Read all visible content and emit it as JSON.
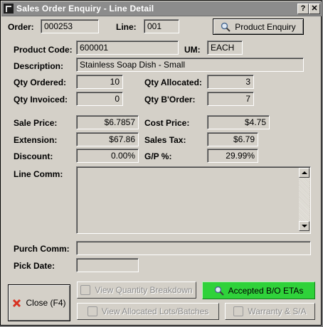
{
  "window": {
    "title": "Sales Order Enquiry - Line Detail",
    "help_label": "?",
    "close_label": "✕"
  },
  "header": {
    "order_label": "Order:",
    "order_value": "000253",
    "line_label": "Line:",
    "line_value": "001",
    "product_enquiry_label": "Product Enquiry"
  },
  "product": {
    "code_label": "Product Code:",
    "code_value": "600001",
    "um_label": "UM:",
    "um_value": "EACH",
    "description_label": "Description:",
    "description_value": "Stainless Soap Dish - Small"
  },
  "quantities": {
    "ordered_label": "Qty Ordered:",
    "ordered_value": "10",
    "allocated_label": "Qty Allocated:",
    "allocated_value": "3",
    "invoiced_label": "Qty Invoiced:",
    "invoiced_value": "0",
    "border_label": "Qty B'Order:",
    "border_value": "7"
  },
  "pricing": {
    "sale_price_label": "Sale Price:",
    "sale_price_value": "$6.7857",
    "cost_price_label": "Cost Price:",
    "cost_price_value": "$4.75",
    "extension_label": "Extension:",
    "extension_value": "$67.86",
    "sales_tax_label": "Sales Tax:",
    "sales_tax_value": "$6.79",
    "discount_label": "Discount:",
    "discount_value": "0.00%",
    "gp_label": "G/P %:",
    "gp_value": "29.99%"
  },
  "comments": {
    "line_comm_label": "Line Comm:",
    "line_comm_value": "",
    "purch_comm_label": "Purch Comm:",
    "purch_comm_value": "",
    "pick_date_label": "Pick Date:",
    "pick_date_value": ""
  },
  "buttons": {
    "close_label": "Close (F4)",
    "view_qty_breakdown_label": "View Quantity Breakdown",
    "accepted_bo_etas_label": "Accepted B/O ETAs",
    "view_allocated_lots_label": "View Allocated Lots/Batches",
    "warranty_label": "Warranty & S/A"
  },
  "colors": {
    "accent_green": "#2fd23a",
    "titlebar": "#8c8c8c",
    "face": "#d4d0c8",
    "close_red": "#d83020"
  },
  "icons": [
    "app-icon",
    "help-icon",
    "window-close-icon",
    "magnifier-icon",
    "close-x-icon",
    "disabled-icon"
  ]
}
